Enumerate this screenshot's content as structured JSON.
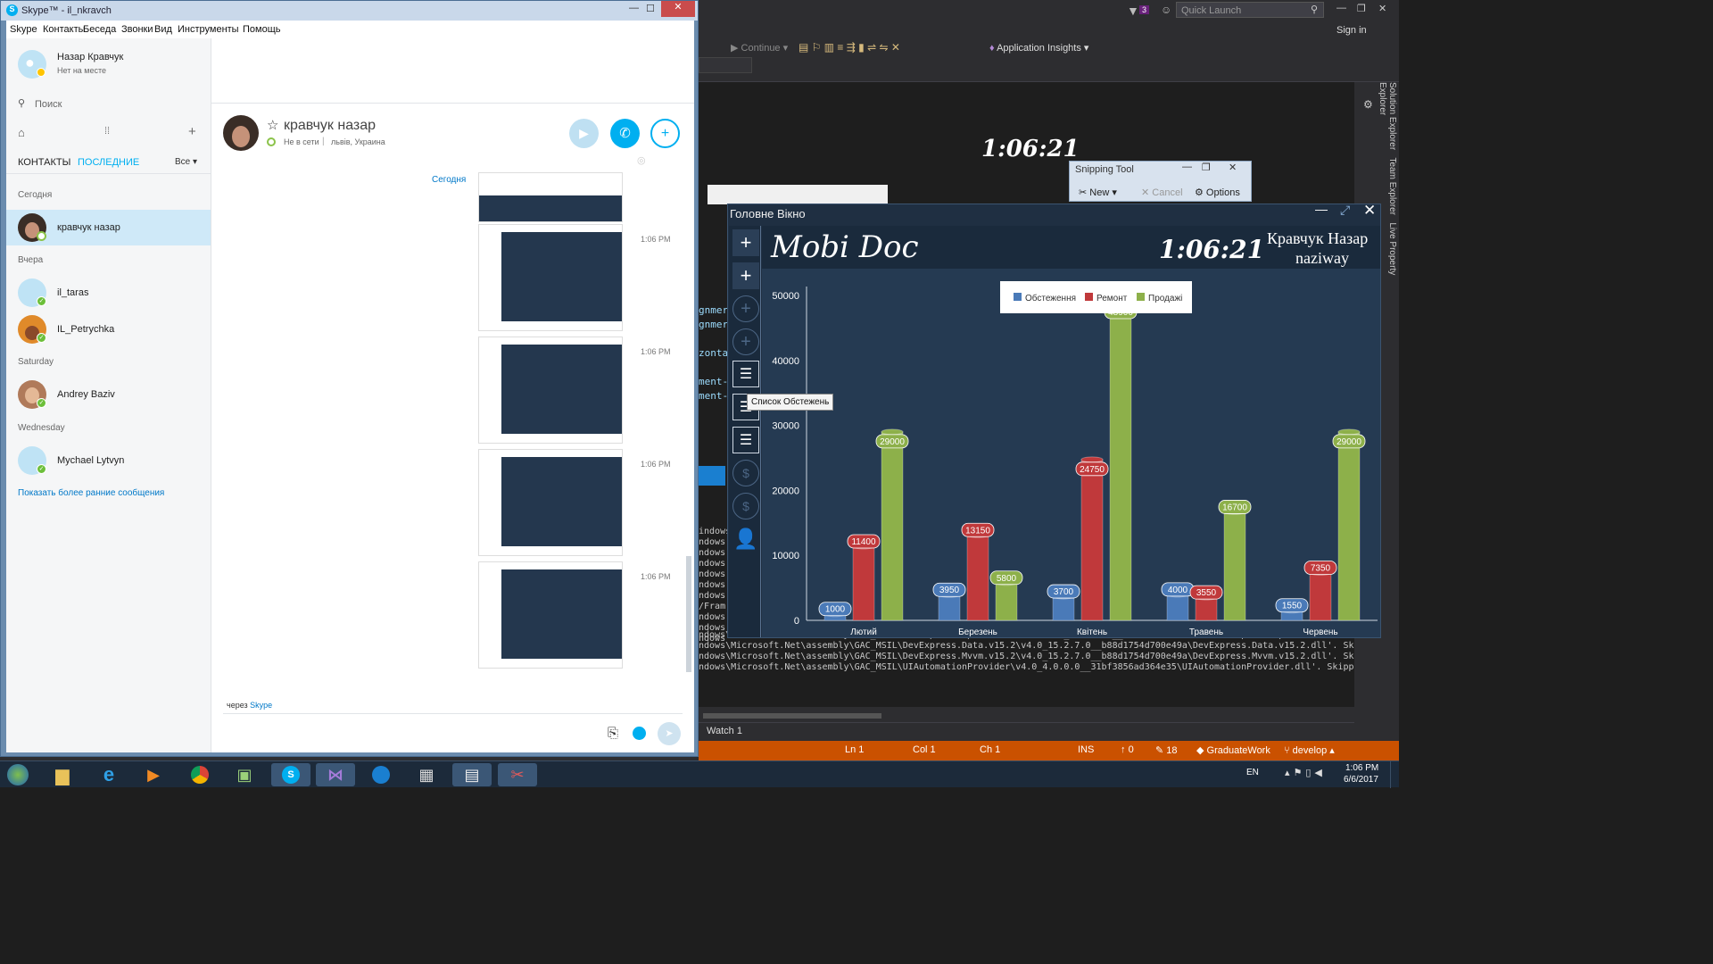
{
  "skype": {
    "window_title": "Skype™ - il_nkravch",
    "menu": [
      "Skype",
      "Контакты",
      "Беседа",
      "Звонки",
      "Вид",
      "Инструменты",
      "Помощь"
    ],
    "profile": {
      "name": "Назар Кравчук",
      "status": "Нет на месте"
    },
    "search_placeholder": "Поиск",
    "tabs": {
      "contacts": "КОНТАКТЫ",
      "recent": "ПОСЛЕДНИЕ",
      "filter": "Все"
    },
    "sections": [
      "Сегодня",
      "Вчера",
      "Saturday",
      "Wednesday"
    ],
    "contacts": [
      {
        "name": "кравчук назар"
      },
      {
        "name": "il_taras"
      },
      {
        "name": "IL_Petrychka"
      },
      {
        "name": "Andrey Baziv"
      },
      {
        "name": "Mychael Lytvyn"
      }
    ],
    "show_earlier": "Показать более ранние сообщения",
    "chat": {
      "name": "кравчук назар",
      "presence": "Не в сети",
      "location": "львів, Украина",
      "day_label": "Сегодня",
      "timestamps": [
        "1:06 PM",
        "1:06 PM",
        "1:06 PM",
        "1:06 PM"
      ],
      "via": "через",
      "via_link": "Skype"
    }
  },
  "vs": {
    "quick_launch": "Quick Launch",
    "notification_count": "3",
    "sign_in": "Sign in",
    "continue_label": "Continue",
    "app_insights": "Application Insights",
    "side_tabs": [
      "Solution Explorer",
      "Team Explorer",
      "Live Property Explorer"
    ],
    "output_lines": [
      "ndows\\Microsoft.Net\\assembly\\GAC_MSIL\\DevExpress.Xpf.Core.v15.2\\v4.0_15.2.7.0__b88d1754d700e49a\\DevExpress.Xpf.Core.v15.2.dll'. Sk",
      "ndows\\Microsoft.Net\\assembly\\GAC_MSIL\\DevExpress.Data.v15.2\\v4.0_15.2.7.0__b88d1754d700e49a\\DevExpress.Data.v15.2.dll'. Skipped loa",
      "ndows\\Microsoft.Net\\assembly\\GAC_MSIL\\DevExpress.Mvvm.v15.2\\v4.0_15.2.7.0__b88d1754d700e49a\\DevExpress.Mvvm.v15.2.dll'. Skipped loa",
      "ndows\\Microsoft.Net\\assembly\\GAC_MSIL\\UIAutomationProvider\\v4.0_4.0.0.0__31bf3856ad364e35\\UIAutomationProvider.dll'. Skipped loadin"
    ],
    "watch": "Watch 1",
    "clock_overlay": "1:06:21",
    "status": {
      "ln": "Ln 1",
      "col": "Col 1",
      "ch": "Ch 1",
      "ins": "INS",
      "up": "0",
      "edits": "18",
      "repo": "GraduateWork",
      "branch": "develop"
    }
  },
  "snipping": {
    "title": "Snipping Tool",
    "new": "New",
    "cancel": "Cancel",
    "options": "Options"
  },
  "mobidoc": {
    "window_title": "Головне Вікно",
    "app_name": "Mobi Doc",
    "clock": "1:06:21",
    "user_name": "Кравчук Назар",
    "user_login": "naziway",
    "tooltip": "Список Обстежень"
  },
  "chart_data": {
    "type": "bar",
    "categories": [
      "Лютий",
      "Березень",
      "Квітень",
      "Травень",
      "Червень"
    ],
    "series": [
      {
        "name": "Обстеження",
        "values": [
          1000,
          3950,
          3700,
          4000,
          1550
        ],
        "color": "#4a7ab8"
      },
      {
        "name": "Ремонт",
        "values": [
          11400,
          13150,
          24750,
          3550,
          7350
        ],
        "color": "#c0393b"
      },
      {
        "name": "Продажі",
        "values": [
          29000,
          5800,
          48900,
          16700,
          29000
        ],
        "color": "#8db04a"
      }
    ],
    "ylim": [
      0,
      50000
    ],
    "yticks": [
      0,
      10000,
      20000,
      30000,
      40000,
      50000
    ],
    "legend": "top-center",
    "grid": false
  },
  "taskbar": {
    "lang": "EN",
    "time": "1:06 PM",
    "date": "6/6/2017",
    "apps": [
      "file-explorer",
      "internet-explorer",
      "media-player",
      "chrome",
      "terminal",
      "skype",
      "visual-studio",
      "teamviewer",
      "calculator",
      "notepad",
      "snipping-tool"
    ]
  }
}
